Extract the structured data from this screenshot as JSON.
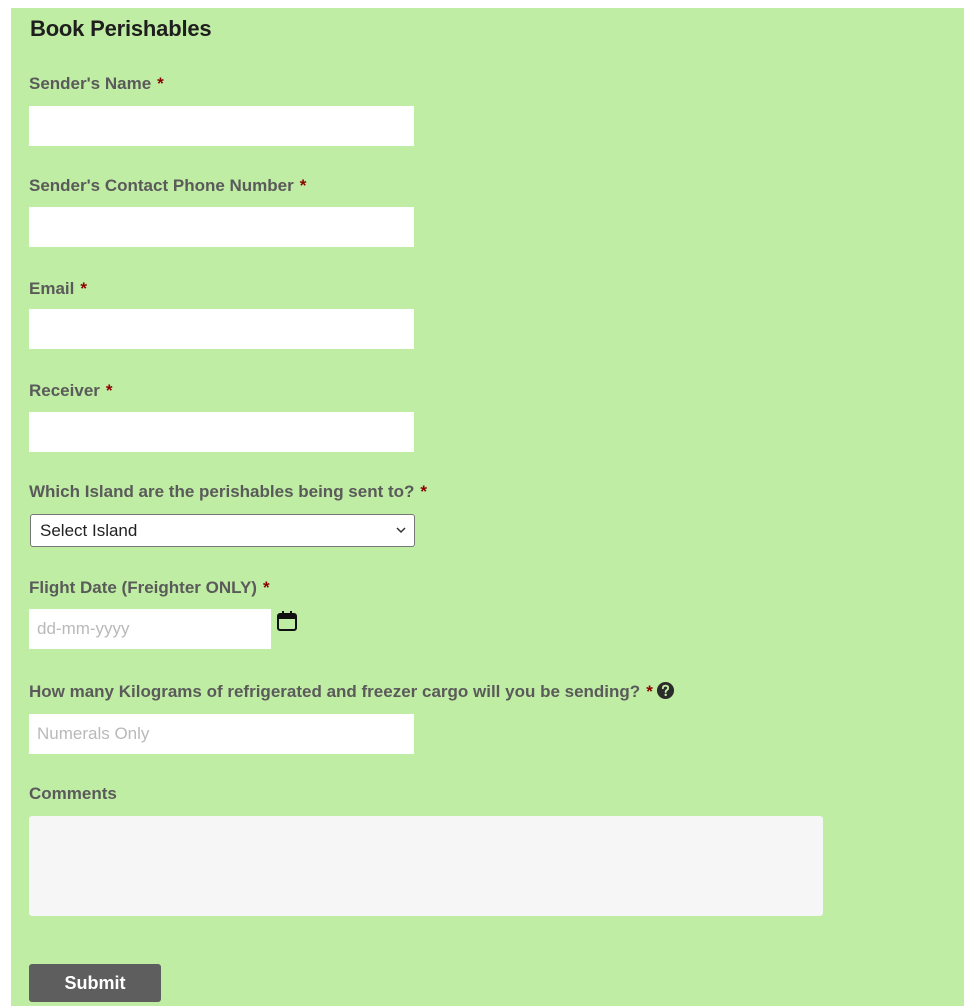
{
  "form": {
    "title": "Book Perishables",
    "required_marker": "*",
    "sender_name": {
      "label": "Sender's Name",
      "value": ""
    },
    "sender_phone": {
      "label": "Sender's Contact Phone Number",
      "value": ""
    },
    "email": {
      "label": "Email",
      "value": ""
    },
    "receiver": {
      "label": "Receiver",
      "value": ""
    },
    "island": {
      "label": "Which Island are the perishables being sent to?",
      "selected": "Select Island",
      "icon": "chevron-down-icon"
    },
    "flight_date": {
      "label": "Flight Date (Freighter ONLY)",
      "placeholder": "dd-mm-yyyy",
      "icon": "calendar-icon"
    },
    "kilograms": {
      "label": "How many Kilograms of refrigerated and freezer cargo will you be sending?",
      "placeholder": "Numerals Only",
      "icon": "question-circle-icon"
    },
    "comments": {
      "label": "Comments",
      "value": ""
    },
    "submit_label": "Submit"
  },
  "colors": {
    "panel_background": "#c0eda4",
    "required_marker": "#8b0000",
    "button_background": "#5e5e5e"
  }
}
